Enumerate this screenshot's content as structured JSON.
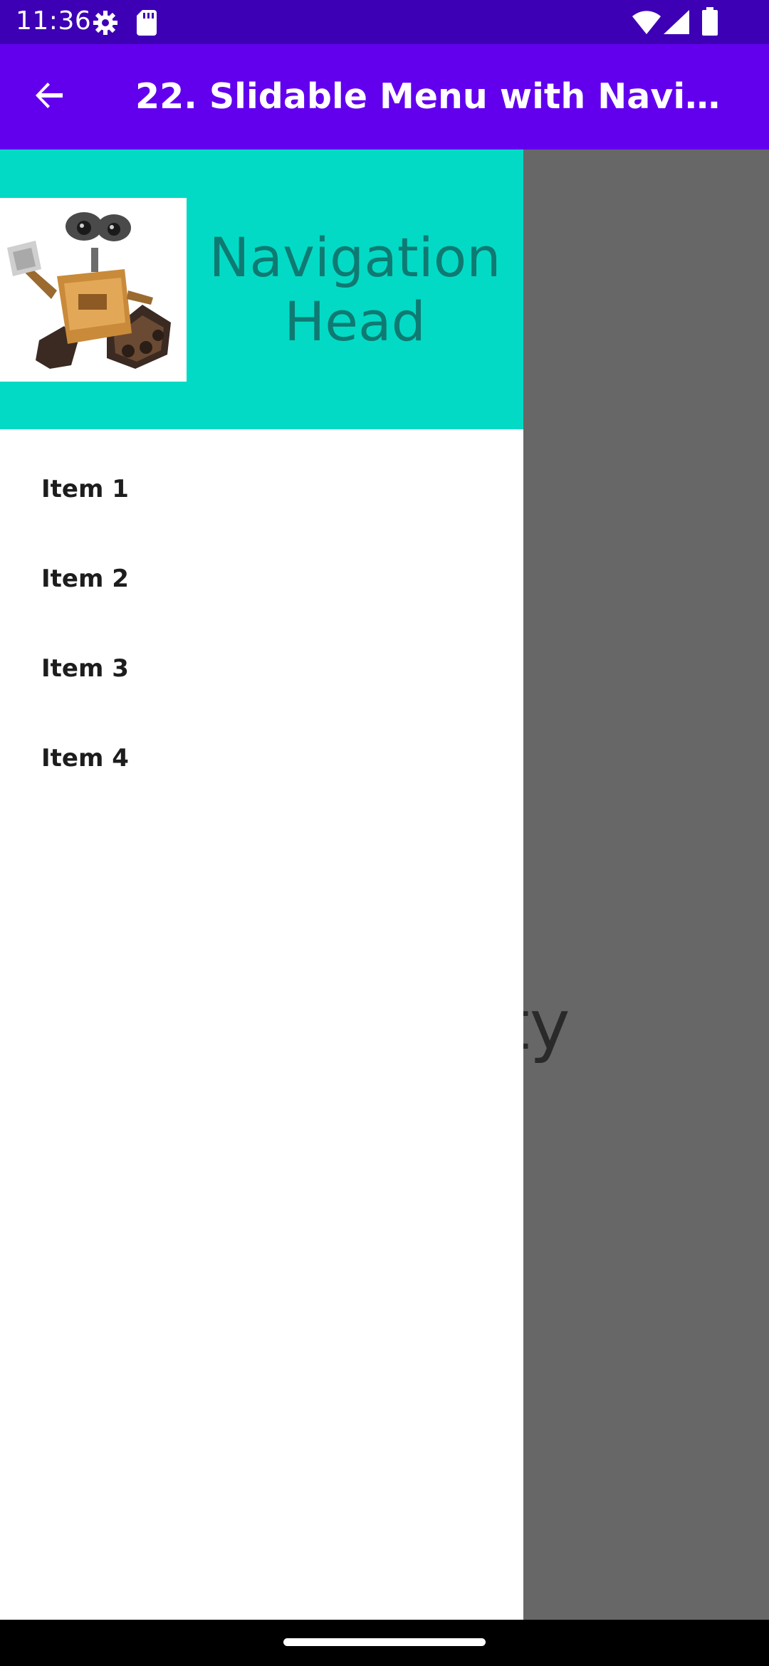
{
  "status_bar": {
    "time": "11:36",
    "icons": [
      "settings-gear-icon",
      "sd-card-icon",
      "wifi-icon",
      "signal-icon",
      "battery-icon"
    ]
  },
  "app_bar": {
    "back_icon": "arrow-back-icon",
    "title": "22. Slidable Menu with Navigati…"
  },
  "content": {
    "visible_text": "ity"
  },
  "drawer": {
    "header": {
      "image": "wall-e-robot-image",
      "title": "Navigation Head",
      "background": "#03dac5",
      "title_color": "#0e7a72"
    },
    "items": [
      {
        "label": "Item 1"
      },
      {
        "label": "Item 2"
      },
      {
        "label": "Item 3"
      },
      {
        "label": "Item 4"
      }
    ]
  },
  "colors": {
    "status_bar": "#3d00b4",
    "app_bar": "#6200ee",
    "scrim": "#676767",
    "nav_bar": "#000000"
  }
}
